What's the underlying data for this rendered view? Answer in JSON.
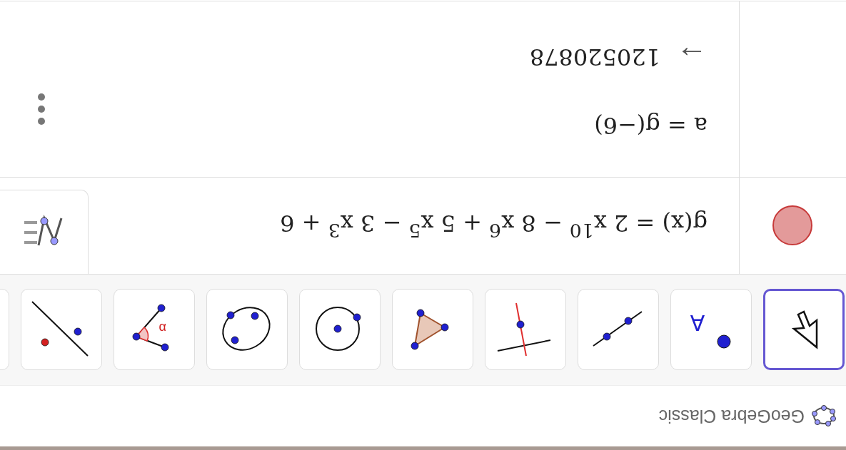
{
  "header": {
    "title": "GeoGebra Classic"
  },
  "tools": [
    {
      "kind": "move",
      "selected": true
    },
    {
      "kind": "point",
      "label": "A",
      "selected": false
    },
    {
      "kind": "line",
      "selected": false
    },
    {
      "kind": "perpendicular",
      "selected": false
    },
    {
      "kind": "polygon",
      "selected": false
    },
    {
      "kind": "circle-center",
      "selected": false
    },
    {
      "kind": "circle-three",
      "selected": false
    },
    {
      "kind": "angle",
      "label": "α",
      "selected": false
    },
    {
      "kind": "reflect",
      "selected": false
    },
    {
      "kind": "partial",
      "selected": false
    }
  ],
  "algebra": [
    {
      "kind": "function",
      "color": "#e39a9a",
      "expression": "g(x) = 2 x$^{10}$ − 8 x$^{6}$ + 5 x$^{5}$ − 3 x$^{3}$ + 6"
    },
    {
      "kind": "number",
      "expression": "a = g(−6)",
      "arrow": "→",
      "result": "120520878"
    }
  ]
}
